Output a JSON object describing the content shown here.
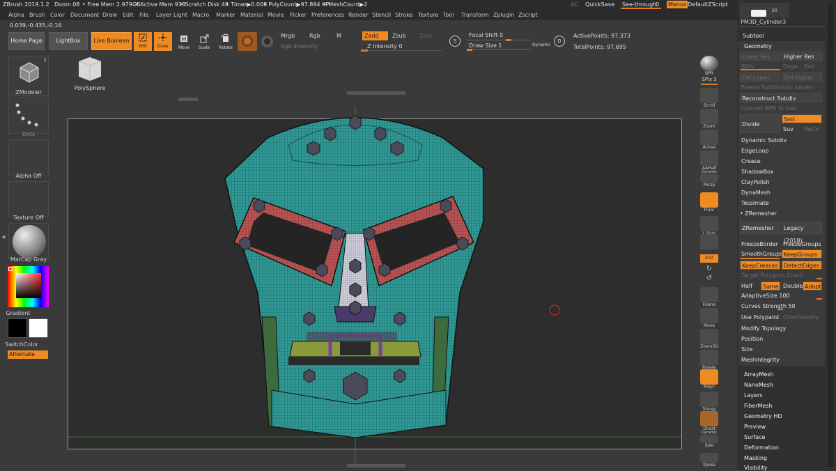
{
  "titlebar": {
    "app": "ZBrush 2019.1.2",
    "doc": "Doom 08",
    "free_mem": "• Free Mem 2.979GB",
    "active_mem": "• Active Mem 918",
    "scratch": "• Scratch Disk 48",
    "timer": "• Timer▶0.008",
    "polycount": "• PolyCount▶97.894 KP",
    "meshcount": "• MeshCount▶2",
    "ac": "AC",
    "quicksave": "QuickSave",
    "see_through_label": "See-through",
    "see_through_value": "0",
    "menus": "Menus",
    "default_zscript": "DefaultZScript"
  },
  "menu": [
    "Alpha",
    "Brush",
    "Color",
    "Document",
    "Draw",
    "Edit",
    "File",
    "Layer",
    "Light",
    "Macro",
    "Marker",
    "Material",
    "Movie",
    "Picker",
    "Preferences",
    "Render",
    "Stencil",
    "Stroke",
    "Texture",
    "Tool",
    "Transform",
    "Zplugin",
    "Zscript"
  ],
  "coords": "0.039,-0.435,-0.16",
  "toolbar": {
    "home_page": "Home Page",
    "lightbox": "LightBox",
    "live_boolean": "Live Boolean",
    "edit": "Edit",
    "draw": "Draw",
    "move": "Move",
    "scale": "Scale",
    "rotate": "Rotate",
    "mrgb": "Mrgb",
    "rgb": "Rgb",
    "m": "M",
    "zadd": "Zadd",
    "zsub": "Zsub",
    "zcut": "Zcut",
    "rgb_intensity": "Rgb Intensity",
    "z_intensity": "Z Intensity 0",
    "focal_shift": "Focal Shift 0",
    "draw_size": "Draw Size 1",
    "dynamic": "Dynamic",
    "active_points": "ActivePoints: 97,373",
    "total_points": "TotalPoints: 97,695"
  },
  "left_shelf": {
    "zmodeler": "ZModeler",
    "zmodeler_badge": "1",
    "dots": "Dots",
    "alpha_off": "Alpha Off",
    "texture_off": "Texture Off",
    "matcap": "MatCap Gray",
    "gradient": "Gradient",
    "switch_color": "SwitchColor",
    "alternate": "Alternate",
    "colors": {
      "main": "#000000",
      "secondary": "#ffffff",
      "accent": "#f08a22"
    }
  },
  "canvas": {
    "polysphere_label": "PolySphere",
    "model_colors": {
      "base": "#2f9a96",
      "eyes": "#b95454",
      "nose": "#c9c9d4",
      "mouth": "#8a9a3a",
      "purple": "#7a3fa0",
      "bolts": "#4a4a5a"
    }
  },
  "right_shelf": {
    "bpr": "BPR",
    "spix": "SPix 3",
    "scroll": "Scroll",
    "zoom": "Zoom",
    "actual": "Actual",
    "aahalf": "AAHalf",
    "dynamic": "Dynamic",
    "persp": "Persp",
    "floor": "Floor",
    "lsym": "L.Sym",
    "xyz": "XYZ",
    "frame": "Frame",
    "move": "Move",
    "zoom3d": "Zoom3D",
    "rotate": "Rotate",
    "polyf": "PolyF",
    "transp": "Transp",
    "ghost": "Ghost",
    "dynamic2": "Dynamic",
    "solo": "Solo",
    "xpose": "Xpose"
  },
  "panel": {
    "thumb_label": "PM3D_Cylinder3",
    "thumb_badge": "20",
    "subtool": "Subtool",
    "geometry": "Geometry",
    "lower_res": "Lower Res",
    "higher_res": "Higher Res",
    "sdiv": "SDiv",
    "cage": "Cage",
    "rstr": "Rstr",
    "del_lower": "Del Lower",
    "del_higher": "Del Higher",
    "freeze_subdiv": "Freeze SubDivision Levels",
    "reconstruct": "Reconstruct Subdiv",
    "convert_bpr": "Convert BPR To Geo",
    "divide": "Divide",
    "smt": "Smt",
    "suv": "Suv",
    "reuv": "ReUV",
    "dynamic_subdiv": "Dynamic Subdiv",
    "edgeloop": "EdgeLoop",
    "crease": "Crease",
    "shadowbox": "ShadowBox",
    "claypolish": "ClayPolish",
    "dynamesh": "DynaMesh",
    "tessimate": "Tessimate",
    "zremesher_header": "• ZRemesher",
    "zremesher": "ZRemesher",
    "legacy": "Legacy (2018)",
    "freeze_border": "FreezeBorder",
    "freeze_groups": "FreezeGroups",
    "smooth_groups": "SmoothGroups",
    "keep_groups": "KeepGroups",
    "keep_creases": "KeepCreases",
    "detect_edges": "DetectEdges",
    "target_poly": "Target Polygons Count",
    "half": "Half",
    "same": "Same",
    "double": "Double",
    "adapt": "Adapt",
    "adaptive_size": "AdaptiveSize 100",
    "curves_strength": "Curves Strength 50",
    "use_polypaint": "Use Polypaint",
    "color_density": "ColorDensity",
    "modify_topology": "Modify Topology",
    "position": "Position",
    "size": "Size",
    "mesh_integrity": "MeshIntegrity",
    "array_mesh": "ArrayMesh",
    "nano_mesh": "NanoMesh",
    "layers": "Layers",
    "fiber_mesh": "FiberMesh",
    "geometry_hd": "Geometry HD",
    "preview": "Preview",
    "surface": "Surface",
    "deformation": "Deformation",
    "masking": "Masking",
    "visibility": "Visibility"
  }
}
